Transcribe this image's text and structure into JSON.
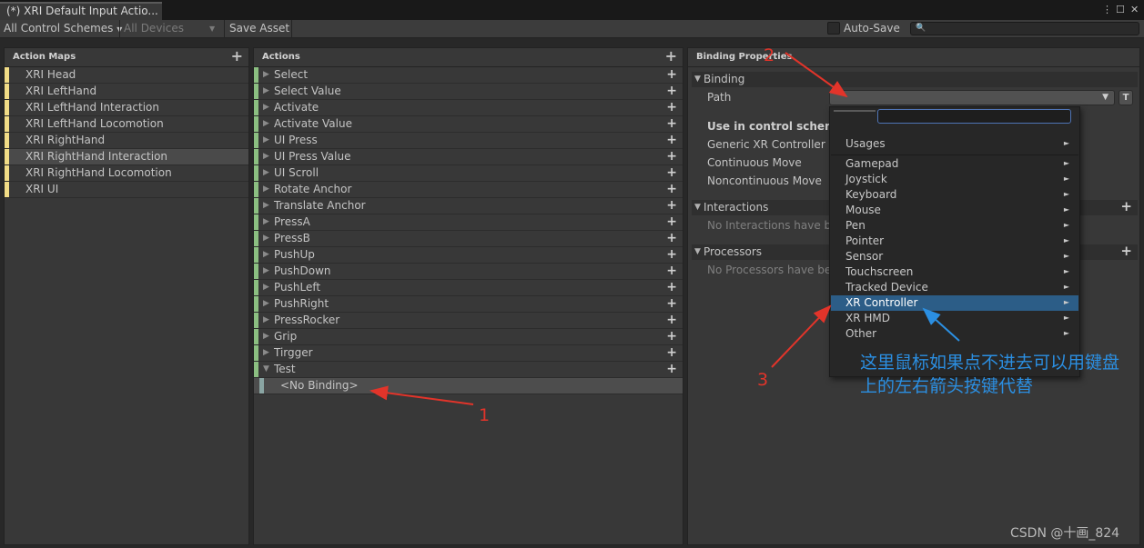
{
  "window": {
    "tab_title": "(*) XRI Default Input Actio...",
    "icons": [
      "more-icon",
      "maximize-icon",
      "close-icon"
    ]
  },
  "toolbar": {
    "control_schemes": "All Control Schemes",
    "devices": "All Devices",
    "save_asset": "Save Asset",
    "auto_save": "Auto-Save",
    "search_icon": "search-icon"
  },
  "action_maps": {
    "header": "Action Maps",
    "accent": "#f1dc86",
    "selected_index": 5,
    "items": [
      "XRI Head",
      "XRI LeftHand",
      "XRI LeftHand Interaction",
      "XRI LeftHand Locomotion",
      "XRI RightHand",
      "XRI RightHand Interaction",
      "XRI RightHand Locomotion",
      "XRI UI"
    ]
  },
  "actions": {
    "header": "Actions",
    "accent": "#8bbf81",
    "items": [
      {
        "label": "Select",
        "expanded": false
      },
      {
        "label": "Select Value",
        "expanded": false
      },
      {
        "label": "Activate",
        "expanded": false
      },
      {
        "label": "Activate Value",
        "expanded": false
      },
      {
        "label": "UI Press",
        "expanded": false
      },
      {
        "label": "UI Press Value",
        "expanded": false
      },
      {
        "label": "UI Scroll",
        "expanded": false
      },
      {
        "label": "Rotate Anchor",
        "expanded": false
      },
      {
        "label": "Translate Anchor",
        "expanded": false
      },
      {
        "label": "PressA",
        "expanded": false
      },
      {
        "label": "PressB",
        "expanded": false
      },
      {
        "label": "PushUp",
        "expanded": false
      },
      {
        "label": "PushDown",
        "expanded": false
      },
      {
        "label": "PushLeft",
        "expanded": false
      },
      {
        "label": "PushRight",
        "expanded": false
      },
      {
        "label": "PressRocker",
        "expanded": false
      },
      {
        "label": "Grip",
        "expanded": false
      },
      {
        "label": "Tirgger",
        "expanded": false
      },
      {
        "label": "Test",
        "expanded": true
      }
    ],
    "binding_label": "<No Binding>"
  },
  "binding_properties": {
    "header": "Binding Properties",
    "binding_section": "Binding",
    "path_label": "Path",
    "t_button": "T",
    "control_scheme_title": "Use in control scheme",
    "schemes": [
      "Generic XR Controller",
      "Continuous Move",
      "Noncontinuous Move"
    ],
    "interactions_section": "Interactions",
    "interactions_empty": "No Interactions have bee",
    "processors_section": "Processors",
    "processors_empty": "No Processors have bee"
  },
  "dropdown": {
    "usages": "Usages",
    "highlight_index": 9,
    "highlight_color": "#2c5d87",
    "items": [
      "Gamepad",
      "Joystick",
      "Keyboard",
      "Mouse",
      "Pen",
      "Pointer",
      "Sensor",
      "Touchscreen",
      "Tracked Device",
      "XR Controller",
      "XR HMD",
      "Other"
    ]
  },
  "annotations": {
    "marker_1": "1",
    "marker_2": "2",
    "marker_3": "3",
    "note": "这里鼠标如果点不进去可以用键盘上的左右箭头按键代替",
    "arrow_color": "#e2342a",
    "note_color": "#2b8fe2"
  },
  "watermark": "CSDN @十画_824"
}
